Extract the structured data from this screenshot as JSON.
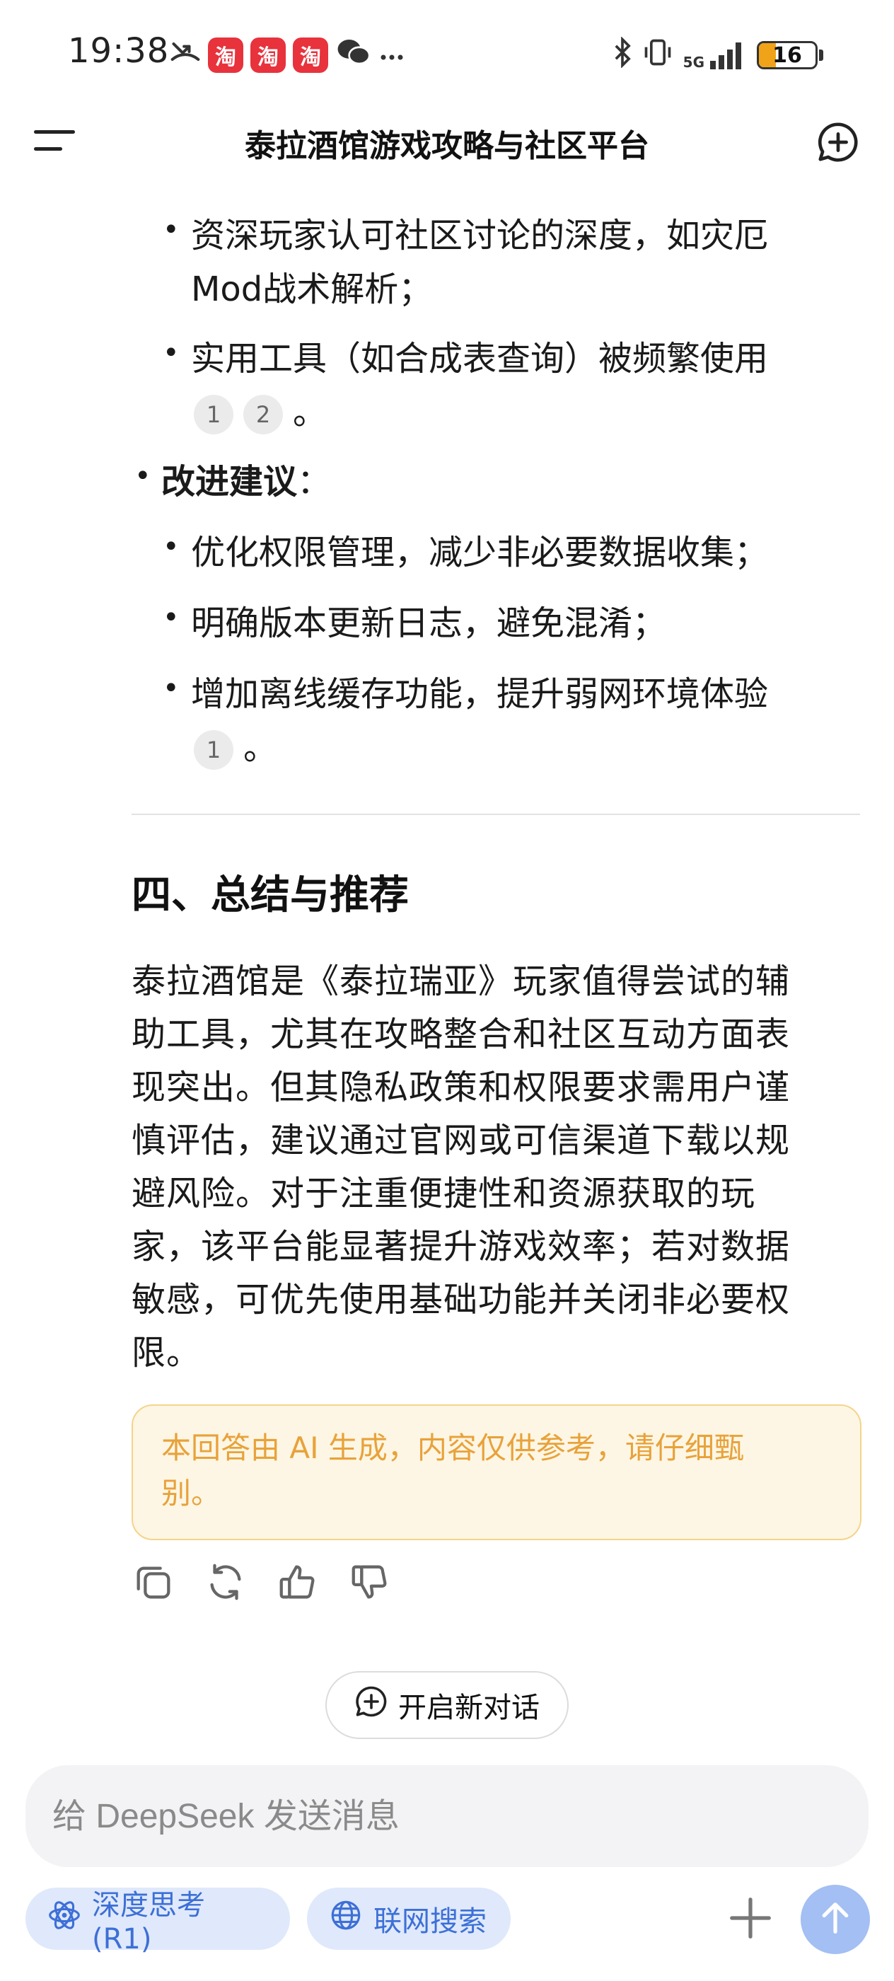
{
  "status_bar": {
    "time": "19:38",
    "app_badge": "淘",
    "battery": "16",
    "network": "5G"
  },
  "header": {
    "title": "泰拉酒馆游戏攻略与社区平台"
  },
  "content": {
    "sub_items_top": [
      {
        "line1": "资深玩家认可社区讨论的深度，如灾厄",
        "line2": "Mod战术解析；"
      },
      {
        "line1": "实用工具（如合成表查询）被频繁使用",
        "cites": [
          "1",
          "2"
        ],
        "tail": "。"
      }
    ],
    "improvement": {
      "label": "改进建议",
      "colon": "：",
      "items": [
        "优化权限管理，减少非必要数据收集；",
        "明确版本更新日志，避免混淆；",
        "增加离线缓存功能，提升弱网环境体验"
      ],
      "last_cite": "1",
      "last_tail": "。"
    },
    "section_title": "四、总结与推荐",
    "summary_lines": [
      "泰拉酒馆是《泰拉瑞亚》玩家值得尝试的辅",
      "助工具，尤其在攻略整合和社区互动方面表",
      "现突出。但其隐私政策和权限要求需用户谨",
      "慎评估，建议通过官网或可信渠道下载以规",
      "避风险。对于注重便捷性和资源获取的玩",
      "家，该平台能显著提升游戏效率；若对数据",
      "敏感，可优先使用基础功能并关闭非必要权",
      "限。"
    ],
    "disclaimer_lines": [
      "本回答由 AI 生成，内容仅供参考，请仔细甄",
      "别。"
    ]
  },
  "new_dialog_label": "开启新对话",
  "input": {
    "placeholder": "给 DeepSeek 发送消息"
  },
  "chips": {
    "deep_think": "深度思考 (R1)",
    "web_search": "联网搜索"
  },
  "colors": {
    "accent": "#3d6fd6",
    "chip_bg": "#dfe9fb",
    "send_bg": "#a3bff3",
    "disclaimer_text": "#e8a23a",
    "disclaimer_bg": "#fdf6e4"
  }
}
